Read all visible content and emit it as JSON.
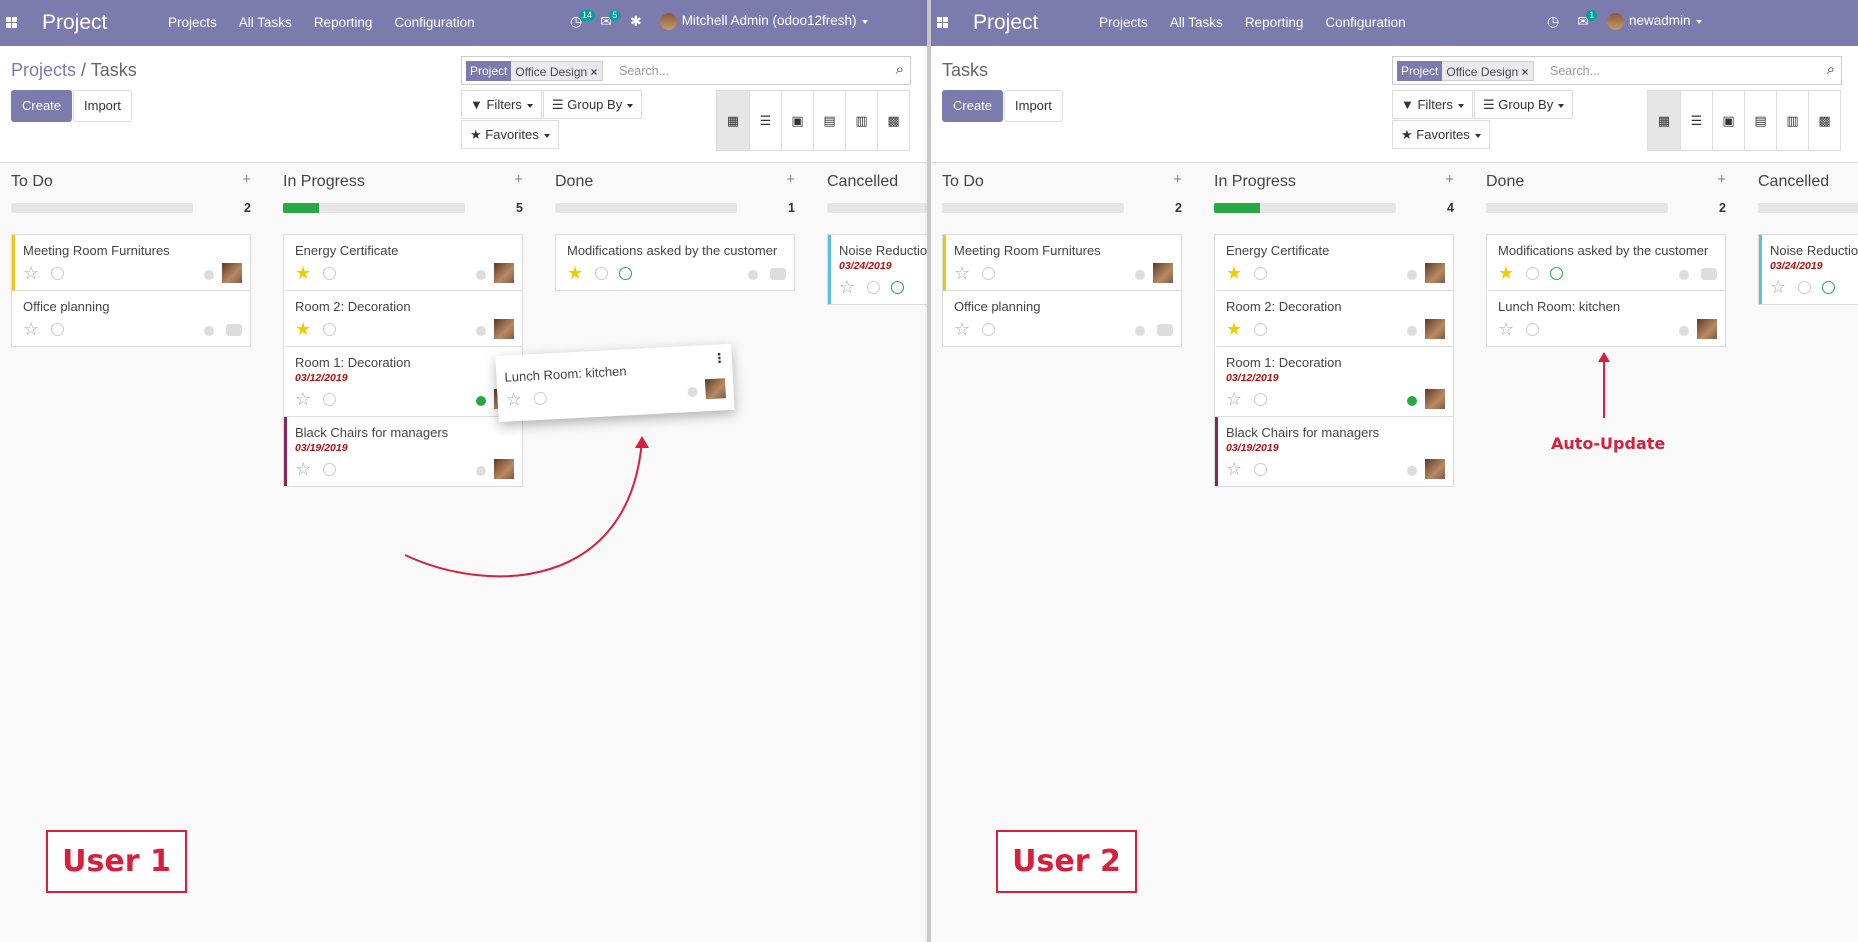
{
  "users": [
    {
      "nav": {
        "brand": "Project",
        "menu": [
          "Projects",
          "All Tasks",
          "Reporting",
          "Configuration"
        ],
        "activity_badge": "14",
        "messages_badge": "5",
        "user": "Mitchell Admin (odoo12fresh)"
      },
      "breadcrumb": {
        "parent": "Projects",
        "separator": "/",
        "current": "Tasks"
      },
      "buttons": {
        "create": "Create",
        "import": "Import"
      },
      "search": {
        "facet_key": "Project",
        "facet_value": "Office Design",
        "placeholder": "Search..."
      },
      "filters": {
        "filters": "Filters",
        "group_by": "Group By",
        "favorites": "Favorites"
      },
      "columns": [
        {
          "title": "To Do",
          "count": "2",
          "progress": 0,
          "cards": [
            {
              "title": "Meeting Room Furnitures",
              "accent": "#f0c419",
              "starred": false,
              "status": "grey",
              "assignee": "avatar"
            },
            {
              "title": "Office planning",
              "starred": false,
              "status": "grey",
              "assignee": "none"
            }
          ]
        },
        {
          "title": "In Progress",
          "count": "5",
          "progress": 0.2,
          "cards": [
            {
              "title": "Energy Certificate",
              "starred": true,
              "status": "grey",
              "assignee": "avatar"
            },
            {
              "title": "Room 2: Decoration",
              "starred": true,
              "status": "grey",
              "assignee": "avatar"
            },
            {
              "title": "Room 1: Decoration",
              "date": "03/12/2019",
              "starred": false,
              "status": "green",
              "assignee": "avatar"
            },
            {
              "title": "Black Chairs for managers",
              "date": "03/19/2019",
              "accent": "#8b2757",
              "starred": false,
              "status": "grey",
              "assignee": "avatar"
            }
          ]
        },
        {
          "title": "Done",
          "count": "1",
          "progress": 0,
          "cards": [
            {
              "title": "Modifications asked by the customer",
              "starred": true,
              "smile": true,
              "status": "grey",
              "assignee": "none"
            }
          ]
        },
        {
          "title": "Cancelled",
          "count": "",
          "progress": 0,
          "cards": [
            {
              "title": "Noise Reduction",
              "date": "03/24/2019",
              "accent": "#5bc0de",
              "starred": false,
              "smile": true
            }
          ]
        }
      ],
      "dragging_card": {
        "title": "Lunch Room: kitchen"
      },
      "label": "User 1"
    },
    {
      "nav": {
        "brand": "Project",
        "menu": [
          "Projects",
          "All Tasks",
          "Reporting",
          "Configuration"
        ],
        "messages_badge": "1",
        "user": "newadmin"
      },
      "breadcrumb": {
        "current": "Tasks"
      },
      "buttons": {
        "create": "Create",
        "import": "Import"
      },
      "search": {
        "facet_key": "Project",
        "facet_value": "Office Design",
        "placeholder": "Search..."
      },
      "filters": {
        "filters": "Filters",
        "group_by": "Group By",
        "favorites": "Favorites"
      },
      "columns": [
        {
          "title": "To Do",
          "count": "2",
          "progress": 0,
          "cards": [
            {
              "title": "Meeting Room Furnitures",
              "accent": "#f0c419",
              "starred": false,
              "status": "grey",
              "assignee": "avatar"
            },
            {
              "title": "Office planning",
              "starred": false,
              "status": "grey",
              "assignee": "none"
            }
          ]
        },
        {
          "title": "In Progress",
          "count": "4",
          "progress": 0.25,
          "cards": [
            {
              "title": "Energy Certificate",
              "starred": true,
              "status": "grey",
              "assignee": "avatar"
            },
            {
              "title": "Room 2: Decoration",
              "starred": true,
              "status": "grey",
              "assignee": "avatar"
            },
            {
              "title": "Room 1: Decoration",
              "date": "03/12/2019",
              "starred": false,
              "status": "green",
              "assignee": "avatar"
            },
            {
              "title": "Black Chairs for managers",
              "date": "03/19/2019",
              "accent": "#8b2757",
              "starred": false,
              "status": "grey",
              "assignee": "avatar"
            }
          ]
        },
        {
          "title": "Done",
          "count": "2",
          "progress": 0,
          "cards": [
            {
              "title": "Modifications asked by the customer",
              "starred": true,
              "smile": true,
              "status": "grey",
              "assignee": "none"
            },
            {
              "title": "Lunch Room: kitchen",
              "starred": false,
              "status": "grey",
              "assignee": "avatar"
            }
          ]
        },
        {
          "title": "Cancelled",
          "count": "",
          "progress": 0,
          "cards": [
            {
              "title": "Noise Reduction",
              "date": "03/24/2019",
              "accent": "#5bc0de",
              "starred": false,
              "smile": true
            }
          ]
        }
      ],
      "annotation": "Auto-Update",
      "label": "User 2"
    }
  ]
}
